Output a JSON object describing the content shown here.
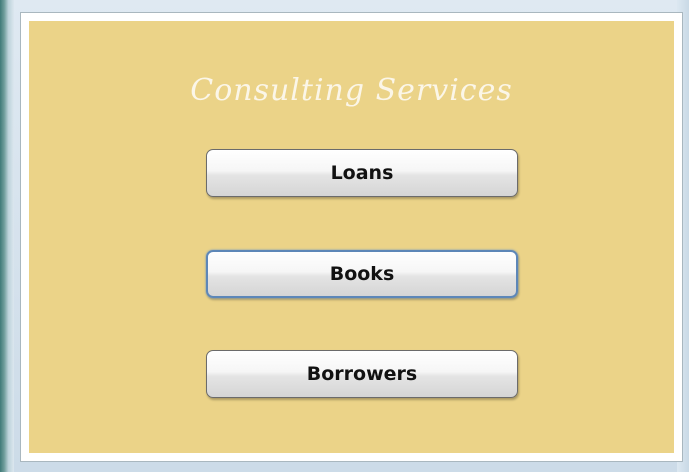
{
  "form": {
    "title": "Consulting Services",
    "background_color": "#ebd388",
    "buttons": [
      {
        "label": "Loans",
        "focused": false
      },
      {
        "label": "Books",
        "focused": true
      },
      {
        "label": "Borrowers",
        "focused": false
      }
    ]
  }
}
